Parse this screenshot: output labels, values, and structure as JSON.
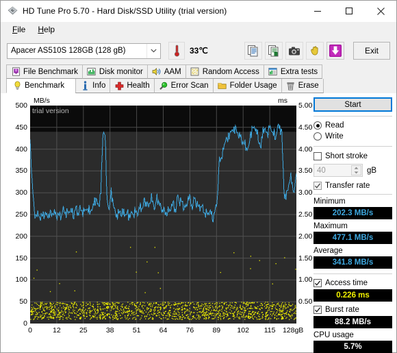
{
  "window": {
    "title": "HD Tune Pro 5.70 - Hard Disk/SSD Utility (trial version)",
    "icon": "hdtune-disk-icon",
    "minimize_label": "minimize-icon",
    "maximize_label": "maximize-icon",
    "close_label": "close-icon"
  },
  "menu": {
    "items": [
      {
        "label": "File",
        "accel": "F"
      },
      {
        "label": "Help",
        "accel": "H"
      }
    ]
  },
  "toolbar": {
    "drive": {
      "value": "Apacer AS510S 128GB (128 gB)",
      "icon": "chevron-down-icon"
    },
    "temperature": {
      "icon": "thermometer-icon",
      "value": "33℃"
    },
    "buttons": [
      {
        "name": "copy-icon"
      },
      {
        "name": "export-excel-icon"
      },
      {
        "name": "camera-icon"
      },
      {
        "name": "hand-icon"
      },
      {
        "name": "download-arrow-icon"
      }
    ],
    "exit_label": "Exit"
  },
  "tabs": {
    "row1": [
      {
        "label": "File Benchmark",
        "icon": "file-benchmark-icon",
        "selected": false
      },
      {
        "label": "Disk monitor",
        "icon": "disk-monitor-icon",
        "selected": false
      },
      {
        "label": "AAM",
        "icon": "speaker-icon",
        "selected": false
      },
      {
        "label": "Random Access",
        "icon": "random-access-icon",
        "selected": false
      },
      {
        "label": "Extra tests",
        "icon": "extra-tests-icon",
        "selected": false
      }
    ],
    "row2": [
      {
        "label": "Benchmark",
        "icon": "lightbulb-icon",
        "selected": true
      },
      {
        "label": "Info",
        "icon": "info-icon",
        "selected": false
      },
      {
        "label": "Health",
        "icon": "health-cross-icon",
        "selected": false
      },
      {
        "label": "Error Scan",
        "icon": "magnifier-icon",
        "selected": false
      },
      {
        "label": "Folder Usage",
        "icon": "folder-icon",
        "selected": false
      },
      {
        "label": "Erase",
        "icon": "trash-icon",
        "selected": false
      }
    ]
  },
  "side_panel": {
    "start_label": "Start",
    "mode": {
      "read_label": "Read",
      "write_label": "Write",
      "selected": "Read"
    },
    "short_stroke": {
      "label": "Short stroke",
      "checked": false,
      "size_value": "40",
      "unit_label": "gB"
    },
    "transfer_rate": {
      "label": "Transfer rate",
      "checked": true,
      "minimum_label": "Minimum",
      "minimum_value": "202.3 MB/s",
      "maximum_label": "Maximum",
      "maximum_value": "477.1 MB/s",
      "average_label": "Average",
      "average_value": "341.8 MB/s"
    },
    "access_time": {
      "label": "Access time",
      "checked": true,
      "value": "0.226 ms"
    },
    "burst_rate": {
      "label": "Burst rate",
      "checked": true,
      "value": "88.2 MB/s"
    },
    "cpu_usage": {
      "label": "CPU usage",
      "value": "5.7%"
    }
  },
  "colors": {
    "transfer_line": "#3ea8e0",
    "access_dots": "#f2f200",
    "plot_bg": "#000000",
    "grid": "#5e5e5e",
    "accent": "#0078d7",
    "value_cyan": "#3ea8e0",
    "value_yellow": "#f2f200",
    "value_white": "#ffffff"
  },
  "chart_data": {
    "type": "line",
    "title": "",
    "watermark": "trial version",
    "xlabel": "128gB",
    "ylabel": "MB/s",
    "y2label": "ms",
    "grid": true,
    "legend": "none",
    "xlim": [
      0,
      128
    ],
    "ylim": [
      0,
      500
    ],
    "y2lim": [
      0,
      5.0
    ],
    "yticks": [
      0,
      50,
      100,
      150,
      200,
      250,
      300,
      350,
      400,
      450,
      500
    ],
    "y2ticks": [
      "0.50",
      "1.00",
      "1.50",
      "2.00",
      "2.50",
      "3.00",
      "3.50",
      "4.00",
      "4.50",
      "5.00"
    ],
    "xticks": [
      "0",
      "12",
      "25",
      "38",
      "51",
      "64",
      "76",
      "89",
      "102",
      "115",
      "128gB"
    ],
    "series": [
      {
        "name": "Transfer rate",
        "unit": "MB/s",
        "axis": "left",
        "color": "#3ea8e0",
        "x": [
          0,
          1,
          2,
          3,
          4,
          5,
          6,
          7,
          8,
          9,
          10,
          11,
          12,
          13,
          14,
          15,
          16,
          17,
          18,
          19,
          20,
          21,
          22,
          23,
          24,
          25,
          26,
          27,
          28,
          29,
          30,
          31,
          32,
          33,
          34,
          35,
          36,
          37,
          38,
          39,
          40,
          41,
          42,
          43,
          44,
          45,
          46,
          47,
          48,
          49,
          50,
          51,
          52,
          53,
          54,
          55,
          56,
          57,
          58,
          59,
          60,
          61,
          62,
          63,
          64,
          65,
          66,
          67,
          68,
          69,
          70,
          71,
          72,
          73,
          74,
          75,
          76,
          77,
          78,
          79,
          80,
          81,
          82,
          83,
          84,
          85,
          86,
          87,
          88,
          89,
          90,
          91,
          92,
          93,
          94,
          95,
          96,
          97,
          98,
          99,
          100,
          101,
          102,
          103,
          104,
          105,
          106,
          107,
          108,
          109,
          110,
          111,
          112,
          113,
          114,
          115,
          116,
          117,
          118,
          119,
          120,
          121,
          122,
          123,
          124,
          125,
          126,
          127,
          128
        ],
        "values": [
          415,
          330,
          246,
          252,
          243,
          249,
          245,
          258,
          243,
          252,
          246,
          256,
          249,
          252,
          247,
          251,
          258,
          255,
          249,
          262,
          256,
          251,
          266,
          253,
          261,
          258,
          253,
          268,
          257,
          263,
          260,
          285,
          277,
          269,
          300,
          440,
          437,
          289,
          256,
          305,
          268,
          255,
          245,
          262,
          250,
          258,
          246,
          253,
          243,
          256,
          252,
          260,
          254,
          268,
          262,
          281,
          275,
          268,
          291,
          278,
          266,
          285,
          279,
          258,
          266,
          249,
          262,
          254,
          274,
          268,
          259,
          291,
          283,
          278,
          270,
          262,
          292,
          280,
          268,
          286,
          279,
          265,
          273,
          260,
          254,
          247,
          260,
          251,
          245,
          258,
          289,
          370,
          382,
          395,
          430,
          418,
          444,
          437,
          449,
          441,
          435,
          428,
          420,
          413,
          405,
          398,
          436,
          444,
          452,
          439,
          420,
          404,
          448,
          441,
          433,
          450,
          445,
          438,
          425,
          453,
          447,
          440,
          300,
          290,
          310,
          340,
          320,
          300,
          345
        ],
        "min": 202.3,
        "max": 477.1,
        "avg": 341.8
      },
      {
        "name": "Access time",
        "unit": "ms",
        "axis": "right",
        "color": "#f2f200",
        "style": "scatter",
        "typical_range": [
          0.1,
          0.5
        ],
        "average": 0.226
      }
    ]
  }
}
